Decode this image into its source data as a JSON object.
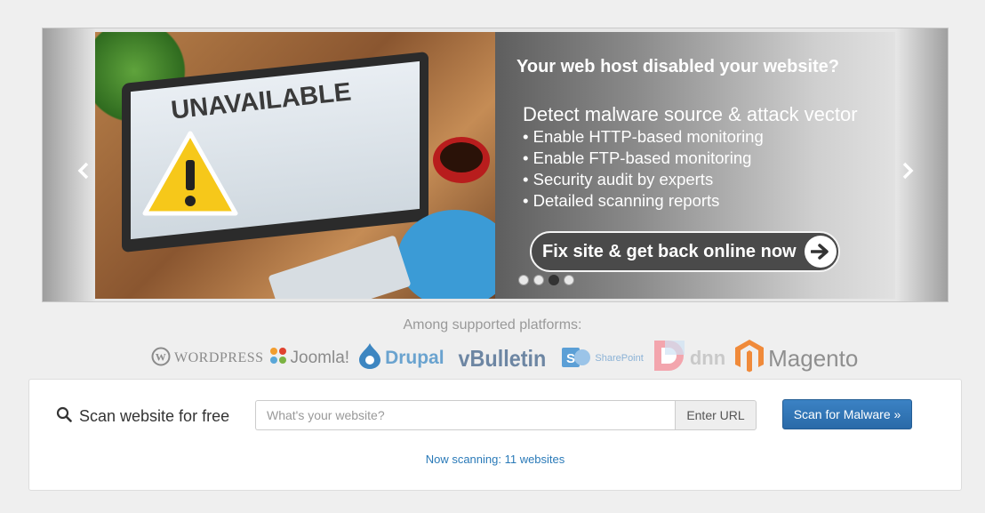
{
  "carousel": {
    "slide": {
      "photo_text": "UNAVAILABLE",
      "title": "Your web host disabled your website?",
      "heading": "Detect malware source & attack vector",
      "bullets": [
        "Enable HTTP-based monitoring",
        "Enable FTP-based monitoring",
        "Security audit by experts",
        "Detailed scanning reports"
      ],
      "cta_label": "Fix site & get back online now"
    },
    "dots_count": 4,
    "active_dot": 3,
    "colors": {
      "panel_text": "#ffffff",
      "cta_bg": "#4a4a4a"
    }
  },
  "platforms": {
    "title": "Among supported platforms:",
    "logos": [
      {
        "name": "WordPress",
        "text": "WORDPRESS",
        "icon": "wordpress-icon"
      },
      {
        "name": "Joomla",
        "text": "Joomla!",
        "icon": "joomla-icon"
      },
      {
        "name": "Drupal",
        "text": "Drupal",
        "icon": "drupal-icon"
      },
      {
        "name": "vBulletin",
        "text": "vBulletin",
        "icon": "vbulletin-icon"
      },
      {
        "name": "SharePoint",
        "text": "SharePoint",
        "icon": "sharepoint-icon"
      },
      {
        "name": "DNN",
        "text": "dnn",
        "icon": "dnn-icon"
      },
      {
        "name": "Magento",
        "text": "Magento",
        "icon": "magento-icon"
      }
    ]
  },
  "scan": {
    "label": "Scan website for free",
    "input_placeholder": "What's your website?",
    "input_value": "",
    "addon_label": "Enter URL",
    "button_label": "Scan for Malware »",
    "status_text": "Now scanning: 11 websites",
    "colors": {
      "button": "#2f74b5",
      "status": "#2a7ab8"
    }
  }
}
